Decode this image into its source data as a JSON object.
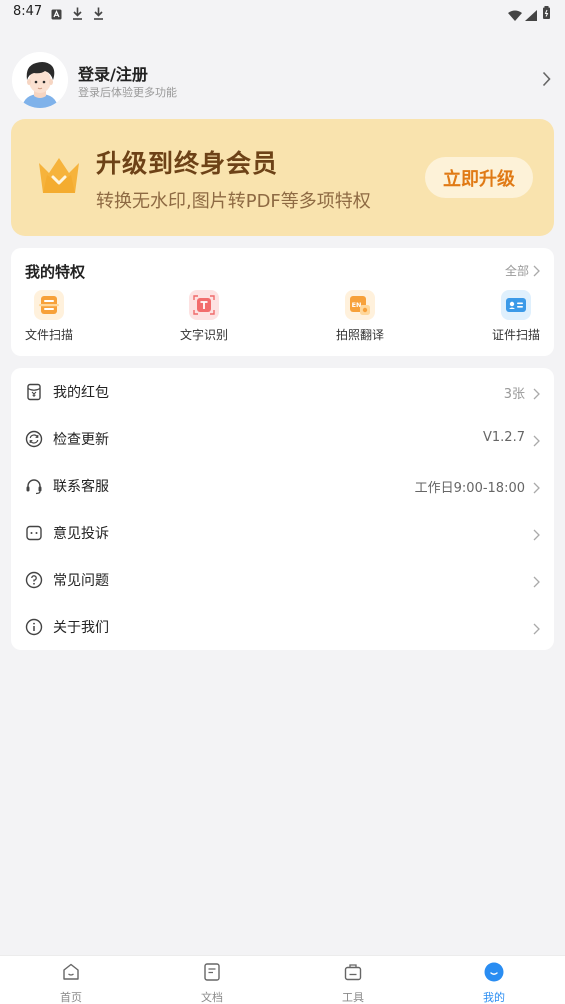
{
  "status_bar": {
    "time": "8:47"
  },
  "profile": {
    "title": "登录/注册",
    "subtitle": "登录后体验更多功能"
  },
  "banner": {
    "title": "升级到终身会员",
    "subtitle": "转换无水印,图片转PDF等多项特权",
    "button_label": "立即升级",
    "colors": {
      "background": "#f9e3ae",
      "title": "#6d4217",
      "button_text": "#e07a15"
    }
  },
  "privileges": {
    "title": "我的特权",
    "all_label": "全部",
    "items": [
      {
        "label": "文件扫描",
        "icon": "document-scan-icon"
      },
      {
        "label": "文字识别",
        "icon": "text-recognition-icon"
      },
      {
        "label": "拍照翻译",
        "icon": "photo-translate-icon"
      },
      {
        "label": "证件扫描",
        "icon": "id-card-scan-icon"
      }
    ]
  },
  "menu": [
    {
      "label": "我的红包",
      "value": "3张",
      "icon": "red-packet-icon"
    },
    {
      "label": "检查更新",
      "value": "V1.2.7",
      "icon": "refresh-icon"
    },
    {
      "label": "联系客服",
      "value": "工作日9:00-18:00",
      "icon": "headset-icon"
    },
    {
      "label": "意见投诉",
      "value": "",
      "icon": "feedback-icon"
    },
    {
      "label": "常见问题",
      "value": "",
      "icon": "question-icon"
    },
    {
      "label": "关于我们",
      "value": "",
      "icon": "info-icon"
    }
  ],
  "bottom_nav": [
    {
      "label": "首页",
      "icon": "home-icon",
      "active": false
    },
    {
      "label": "文档",
      "icon": "document-icon",
      "active": false
    },
    {
      "label": "工具",
      "icon": "toolbox-icon",
      "active": false
    },
    {
      "label": "我的",
      "icon": "profile-icon",
      "active": true
    }
  ],
  "accent_color": "#2a8df2"
}
